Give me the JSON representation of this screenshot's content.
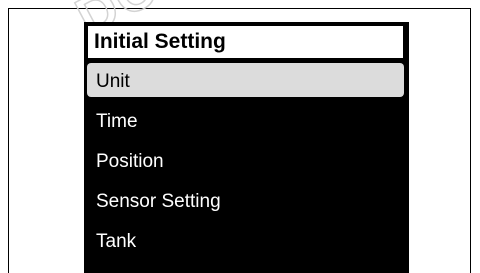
{
  "watermark": {
    "text": "DO"
  },
  "screen": {
    "title": "Initial Setting",
    "menu": {
      "items": [
        {
          "label": "Unit",
          "selected": true
        },
        {
          "label": "Time",
          "selected": false
        },
        {
          "label": "Position",
          "selected": false
        },
        {
          "label": "Sensor Setting",
          "selected": false
        },
        {
          "label": "Tank",
          "selected": false
        }
      ]
    }
  },
  "colors": {
    "screen_bg": "#000000",
    "selected_bg": "#dcdcdc",
    "text_light": "#ffffff",
    "text_dark": "#000000"
  }
}
